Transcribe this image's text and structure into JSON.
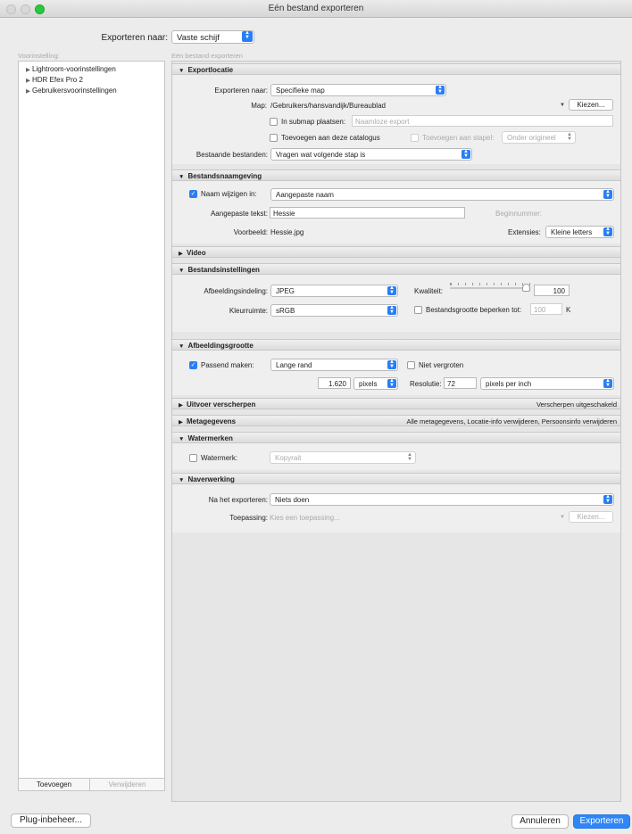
{
  "window": {
    "title": "Eén bestand exporteren"
  },
  "export_to": {
    "label": "Exporteren naar:",
    "value": "Vaste schijf"
  },
  "columns": {
    "presets": "Voorinstelling:",
    "main": "Eén bestand exporteren"
  },
  "presets": {
    "items": [
      "Lightroom-voorinstellingen",
      "HDR Efex Pro 2",
      "Gebruikersvoorinstellingen"
    ],
    "add_label": "Toevoegen",
    "remove_label": "Verwijderen"
  },
  "export_location": {
    "title": "Exportlocatie",
    "export_to_label": "Exporteren naar:",
    "export_to_value": "Specifieke map",
    "folder_label": "Map:",
    "folder_path": "/Gebruikers/hansvandijk/Bureaublad",
    "choose_label": "Kiezen...",
    "subfolder_label": "In submap plaatsen:",
    "subfolder_placeholder": "Naamloze export",
    "add_catalog_label": "Toevoegen aan deze catalogus",
    "add_stack_label": "Toevoegen aan stapel:",
    "stack_value": "Onder origineel",
    "existing_label": "Bestaande bestanden:",
    "existing_value": "Vragen wat volgende stap is"
  },
  "file_naming": {
    "title": "Bestandsnaamgeving",
    "rename_label": "Naam wijzigen in:",
    "rename_value": "Aangepaste naam",
    "custom_text_label": "Aangepaste tekst:",
    "custom_text_value": "Hessie",
    "start_number_label": "Beginnummer:",
    "example_label": "Voorbeeld:",
    "example_value": "Hessie.jpg",
    "extensions_label": "Extensies:",
    "extensions_value": "Kleine letters"
  },
  "video": {
    "title": "Video"
  },
  "file_settings": {
    "title": "Bestandsinstellingen",
    "format_label": "Afbeeldingsindeling:",
    "format_value": "JPEG",
    "quality_label": "Kwaliteit:",
    "quality_value": "100",
    "colorspace_label": "Kleurruimte:",
    "colorspace_value": "sRGB",
    "limit_size_label": "Bestandsgrootte beperken tot:",
    "limit_size_value": "100",
    "limit_size_unit": "K"
  },
  "image_sizing": {
    "title": "Afbeeldingsgrootte",
    "resize_label": "Passend maken:",
    "resize_value": "Lange rand",
    "no_enlarge_label": "Niet vergroten",
    "size_value": "1.620",
    "size_unit": "pixels",
    "resolution_label": "Resolutie:",
    "resolution_value": "72",
    "resolution_unit": "pixels per inch"
  },
  "output_sharpening": {
    "title": "Uitvoer verscherpen",
    "summary": "Verscherpen uitgeschakeld"
  },
  "metadata": {
    "title": "Metagegevens",
    "summary": "Alle metagegevens, Locatie-info verwijderen, Persoonsinfo verwijderen"
  },
  "watermark": {
    "title": "Watermerken",
    "label": "Watermerk:",
    "value": "Kopyrait"
  },
  "post_processing": {
    "title": "Naverwerking",
    "after_export_label": "Na het exporteren:",
    "after_export_value": "Niets doen",
    "application_label": "Toepassing:",
    "application_placeholder": "Kies een toepassing...",
    "choose_label": "Kiezen..."
  },
  "footer": {
    "plugin_manager": "Plug-inbeheer...",
    "cancel": "Annuleren",
    "export": "Exporteren"
  }
}
